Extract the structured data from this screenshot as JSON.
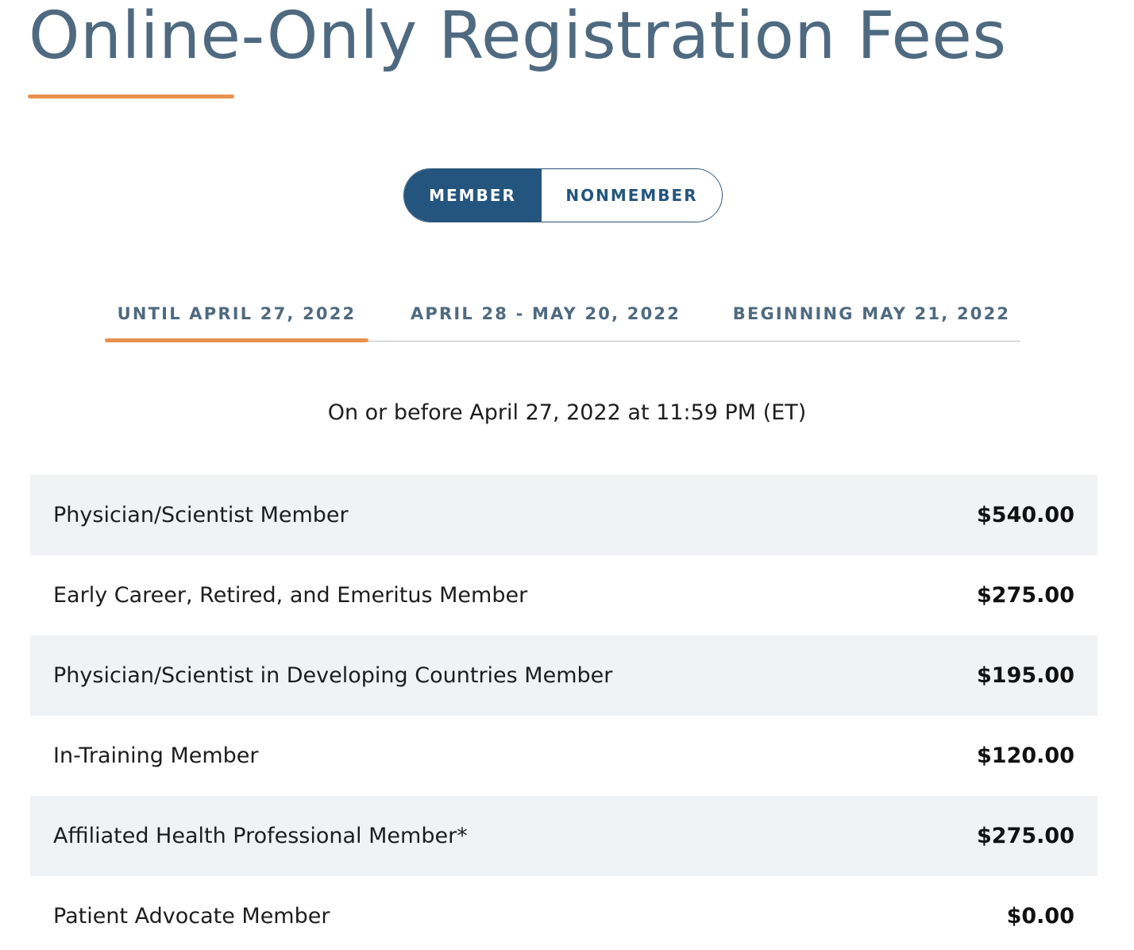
{
  "header": {
    "title": "Online-Only Registration Fees"
  },
  "membership_toggle": {
    "options": [
      {
        "label": "MEMBER",
        "selected": true
      },
      {
        "label": "NONMEMBER",
        "selected": false
      }
    ]
  },
  "period_tabs": {
    "active_index": 0,
    "items": [
      {
        "label": "UNTIL APRIL 27, 2022"
      },
      {
        "label": "APRIL 28 - MAY 20, 2022"
      },
      {
        "label": "BEGINNING MAY 21, 2022"
      }
    ]
  },
  "period_note": "On or before April 27, 2022 at 11:59 PM (ET)",
  "fees": [
    {
      "category": "Physician/Scientist Member",
      "price": "$540.00"
    },
    {
      "category": "Early Career, Retired, and Emeritus Member",
      "price": "$275.00"
    },
    {
      "category": "Physician/Scientist in Developing Countries Member",
      "price": "$195.00"
    },
    {
      "category": "In-Training Member",
      "price": "$120.00"
    },
    {
      "category": "Affiliated Health Professional Member*",
      "price": "$275.00"
    },
    {
      "category": "Patient Advocate Member",
      "price": "$0.00"
    }
  ],
  "colors": {
    "title_text": "#4f6a80",
    "accent_orange": "#e8914f",
    "toggle_active_bg": "#24557e",
    "row_shade": "#f1f2f4"
  }
}
